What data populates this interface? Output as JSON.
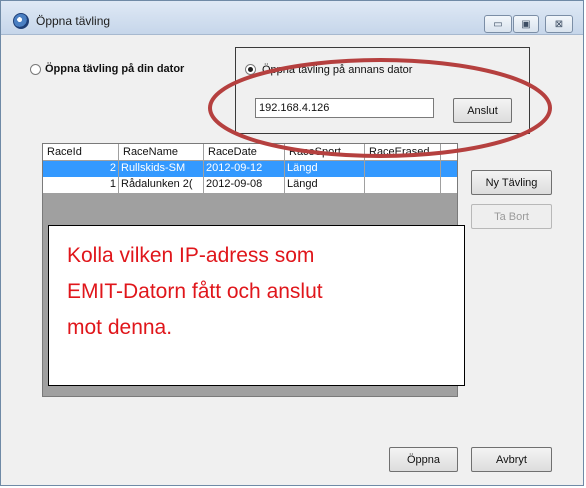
{
  "window": {
    "title": "Öppna tävling",
    "minimize_glyph": "▭",
    "maximize_glyph": "▣",
    "close_glyph": "⊠"
  },
  "options": {
    "local_label": "Öppna tävling på din dator",
    "remote_label": "Öppna tävling på annans dator",
    "selected": "remote"
  },
  "connection": {
    "ip_value": "192.168.4.126",
    "connect_label": "Anslut"
  },
  "race_grid": {
    "columns": [
      "RaceId",
      "RaceName",
      "RaceDate",
      "RaceSport",
      "RaceErased"
    ],
    "rows": [
      {
        "id": "2",
        "name": "Rullskids-SM",
        "date": "2012-09-12",
        "sport": "Längd",
        "erased": "",
        "selected": true
      },
      {
        "id": "1",
        "name": "Rådalunken 2(",
        "date": "2012-09-08",
        "sport": "Längd",
        "erased": "",
        "selected": false
      }
    ]
  },
  "side_buttons": {
    "new_label": "Ny Tävling",
    "delete_label": "Ta Bort"
  },
  "footer": {
    "open_label": "Öppna",
    "cancel_label": "Avbryt"
  },
  "annotation": {
    "lines": [
      "Kolla vilken IP-adress som",
      "EMIT-Datorn fått och anslut",
      "mot denna."
    ],
    "text_color": "#e0161b",
    "ellipse_color": "#b5403f"
  },
  "colors": {
    "selection": "#3399ff",
    "grid_background": "#a0a0a0"
  }
}
